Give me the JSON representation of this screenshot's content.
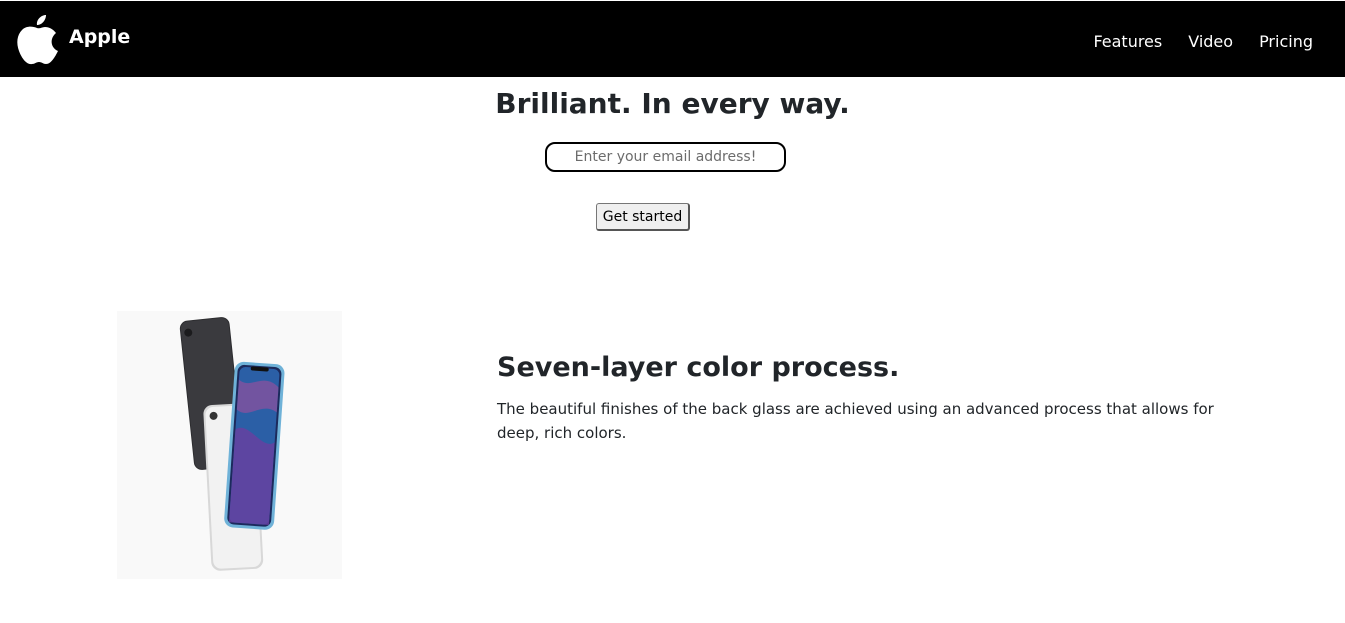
{
  "header": {
    "brand": "Apple",
    "logo_icon": "apple-logo-icon",
    "nav": [
      {
        "label": "Features"
      },
      {
        "label": "Video"
      },
      {
        "label": "Pricing"
      }
    ]
  },
  "hero": {
    "title": "Brilliant. In every way.",
    "email_placeholder": "Enter your email address!",
    "cta_label": "Get started"
  },
  "feature": {
    "image": "iphone-xr-product-image",
    "title": "Seven-layer color process.",
    "description": "The beautiful finishes of the back glass are achieved using an advanced process that allows for deep, rich colors."
  }
}
